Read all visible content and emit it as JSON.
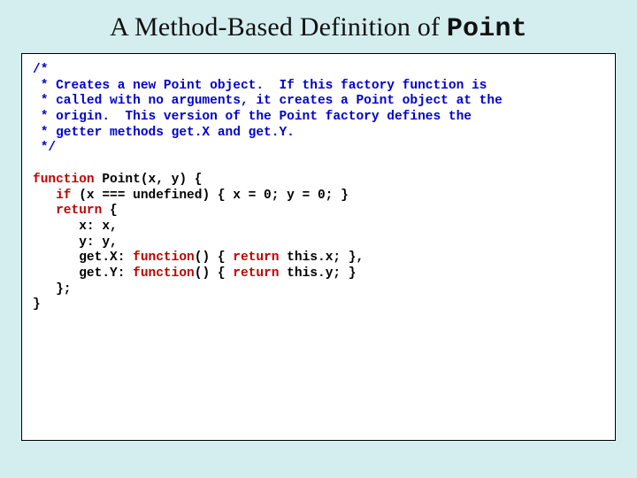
{
  "title_prefix": "A Method-Based Definition of ",
  "title_mono": "Point",
  "code": {
    "c_open": "/*",
    "c1": " * Creates a new Point object.  If this factory function is",
    "c2": " * called with no arguments, it creates a Point object at the",
    "c3": " * origin.  This version of the Point factory defines the",
    "c4": " * getter methods get.X and get.Y.",
    "c_close": " */",
    "kw_function1": "function",
    "l1_rest": " Point(x, y) {",
    "kw_if": "if",
    "l2_rest": " (x === undefined) { x = 0; y = 0; }",
    "kw_return": "return",
    "l3_rest": " {",
    "l4": "      x: x,",
    "l5": "      y: y,",
    "l6a": "      get.X: ",
    "kw_function2": "function",
    "l6b": "() { ",
    "kw_return2": "return",
    "l6c": " this.x; },",
    "l7a": "      get.Y: ",
    "kw_function3": "function",
    "l7b": "() { ",
    "kw_return3": "return",
    "l7c": " this.y; }",
    "l8": "   };",
    "l9": "}"
  }
}
